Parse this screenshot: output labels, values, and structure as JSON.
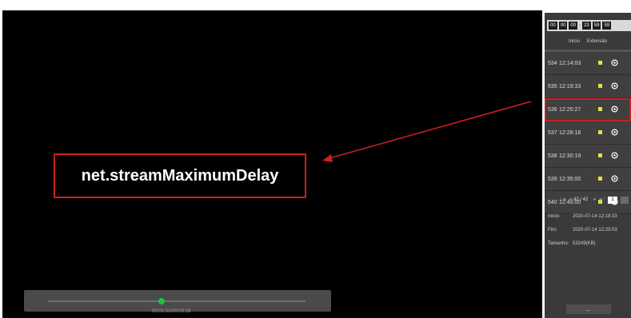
{
  "video": {
    "annotation_text": "net.streamMaximumDelay",
    "time_display": "00:01:31/00:03:29",
    "progress_fraction": 0.44
  },
  "side": {
    "range": {
      "start_h": "00",
      "start_m": "00",
      "start_s": "00",
      "sep": "-",
      "end_h": "23",
      "end_m": "59",
      "end_s": "59"
    },
    "headers": {
      "start": "Inicio",
      "length": "Extensão"
    },
    "records": [
      {
        "id": "534",
        "time": "12:14:03"
      },
      {
        "id": "535",
        "time": "12:19:33"
      },
      {
        "id": "536",
        "time": "12:25:27"
      },
      {
        "id": "537",
        "time": "12:28:18"
      },
      {
        "id": "538",
        "time": "12:30:19"
      },
      {
        "id": "539",
        "time": "12:35:00"
      },
      {
        "id": "540",
        "time": "12:40:00"
      }
    ],
    "selected_record": "536",
    "pager": {
      "prev": "|◄ ◄",
      "count": "42 / 42",
      "next": "► ►|",
      "page_input": "1"
    },
    "info": {
      "start_label": "Inicio:",
      "start_value": "2020-07-14 12:19:33",
      "end_label": "Fim:",
      "end_value": "2020-07-14 12:23:03",
      "size_label": "Tamanho:",
      "size_value": "53249(KB)"
    },
    "back_label": "←"
  },
  "colors": {
    "annotation": "#cc1f1f",
    "progress_dot": "#22c33b",
    "marker_yellow": "#e8e03a"
  }
}
